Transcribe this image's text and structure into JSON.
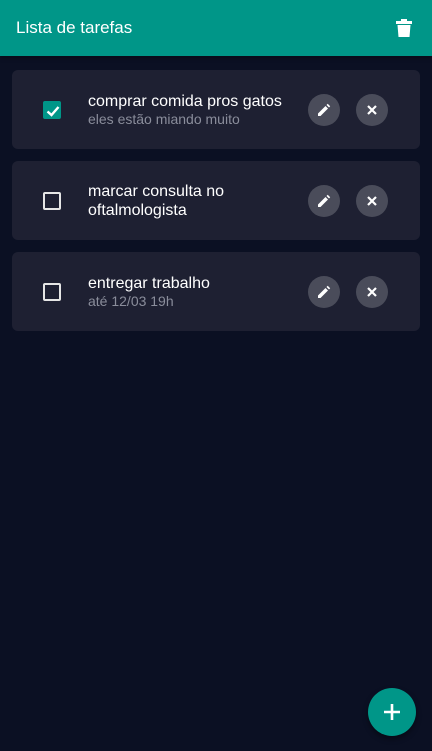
{
  "appbar": {
    "title": "Lista de tarefas",
    "action_icon": "trash-icon"
  },
  "colors": {
    "primary": "#009688",
    "background": "#0b1023",
    "card": "#1e2032",
    "button": "#4a4c5a"
  },
  "tasks": [
    {
      "title": "comprar comida pros gatos",
      "subtitle": "eles estão miando muito",
      "checked": true
    },
    {
      "title": "marcar consulta no oftalmologista",
      "subtitle": "",
      "checked": false
    },
    {
      "title": "entregar trabalho",
      "subtitle": "até 12/03 19h",
      "checked": false
    }
  ],
  "fab": {
    "icon": "plus-icon"
  }
}
